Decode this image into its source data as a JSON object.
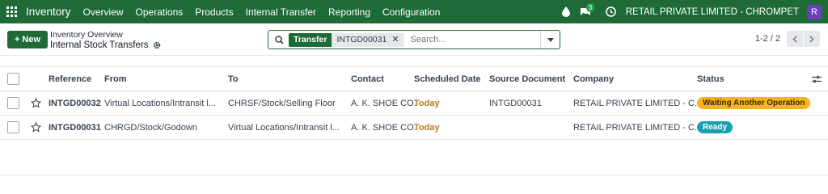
{
  "navbar": {
    "brand": "Inventory",
    "menu": [
      "Overview",
      "Operations",
      "Products",
      "Internal Transfer",
      "Reporting",
      "Configuration"
    ],
    "messages_count": "3",
    "company": "RETAIL PRIVATE LIMITED - CHROMPET",
    "avatar_letter": "R",
    "bg_color": "#1e6b38"
  },
  "control_panel": {
    "new_label": "New",
    "breadcrumb_parent": "Inventory Overview",
    "breadcrumb_current": "Internal Stock Transfers",
    "search": {
      "facet_key": "Transfer",
      "facet_value": "INTGD00031",
      "placeholder": "Search..."
    },
    "pager": "1-2 / 2"
  },
  "table": {
    "columns": [
      "Reference",
      "From",
      "To",
      "Contact",
      "Scheduled Date",
      "Source Document",
      "Company",
      "Status"
    ],
    "rows": [
      {
        "reference": "INTGD00032",
        "from": "Virtual Locations/Intransit l...",
        "to": "CHRSF/Stock/Selling Floor",
        "contact": "A. K. SHOE CO.",
        "scheduled_date": "Today",
        "source_document": "INTGD00031",
        "company": "RETAIL PRIVATE LIMITED - C...",
        "status": "Waiting Another Operation"
      },
      {
        "reference": "INTGD00031",
        "from": "CHRGD/Stock/Godown",
        "to": "Virtual Locations/Intransit l...",
        "contact": "A. K. SHOE CO.",
        "scheduled_date": "Today",
        "source_document": "",
        "company": "RETAIL PRIVATE LIMITED - C...",
        "status": "Ready"
      }
    ]
  }
}
